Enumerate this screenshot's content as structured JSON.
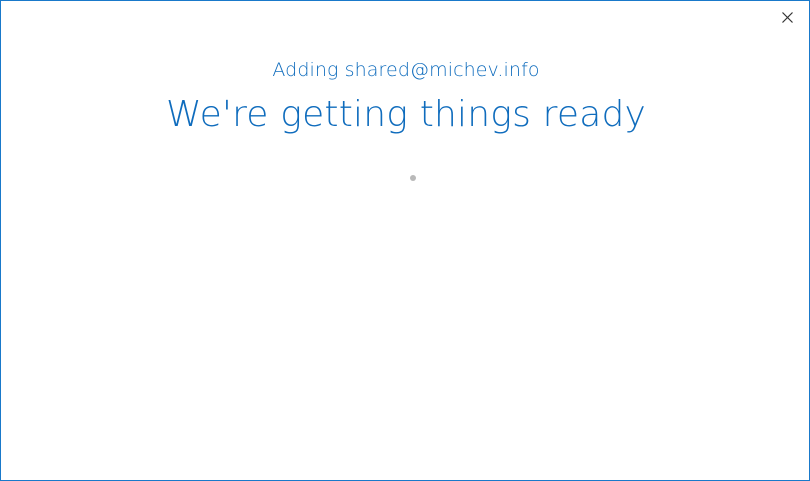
{
  "dialog": {
    "subtitle": "Adding shared@michev.info",
    "title": "We're getting things ready"
  },
  "icons": {
    "close": "close-icon",
    "progress": "progress-dot"
  },
  "colors": {
    "accent": "#0f6cbd",
    "border": "#1979ca",
    "spinner": "#b9b9b9"
  }
}
